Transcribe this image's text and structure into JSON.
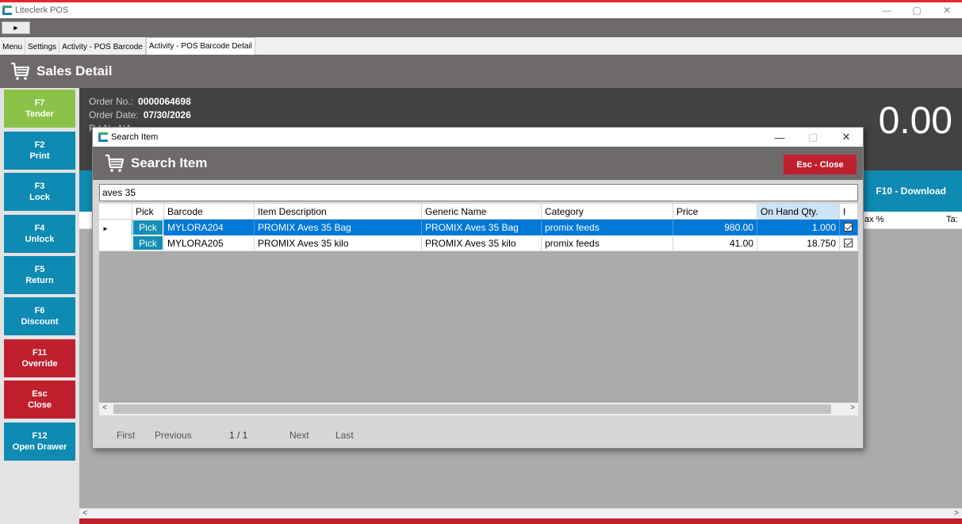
{
  "app": {
    "title": "Liteclerk POS"
  },
  "window_controls": {
    "minimize": "—",
    "maximize": "▢",
    "close": "✕"
  },
  "toolbar": {
    "play": "►"
  },
  "tabs": [
    "Menu",
    "Settings",
    "Activity - POS Barcode",
    "Activity - POS Barcode Detail"
  ],
  "header": {
    "title": "Sales Detail",
    "icon": "cart-icon"
  },
  "function_keys": [
    {
      "key": "F7",
      "label": "Tender",
      "color": "#8bc34a"
    },
    {
      "key": "F2",
      "label": "Print",
      "color": "#0e8ab3"
    },
    {
      "key": "F3",
      "label": "Lock",
      "color": "#0e8ab3"
    },
    {
      "key": "F4",
      "label": "Unlock",
      "color": "#0e8ab3"
    },
    {
      "key": "F5",
      "label": "Return",
      "color": "#0e8ab3"
    },
    {
      "key": "F6",
      "label": "Discount",
      "color": "#0e8ab3"
    },
    {
      "key": "F11",
      "label": "Override",
      "color": "#c0202e"
    },
    {
      "key": "Esc",
      "label": "Close",
      "color": "#c0202e"
    },
    {
      "key": "F12",
      "label": "Open Drawer",
      "color": "#0e8ab3"
    }
  ],
  "order": {
    "order_no_label": "Order No.:",
    "order_no": "0000064698",
    "order_date_label": "Order Date:",
    "order_date": "07/30/2026",
    "partial_label": "R    t N  : NA",
    "total": "0.00"
  },
  "background": {
    "download_button": "F10 - Download",
    "columns_visible": [
      "ax %",
      "Ta:"
    ]
  },
  "dialog": {
    "title": "Search Item",
    "heading": "Search Item",
    "close_button": "Esc - Close",
    "search_value": "aves 35",
    "columns": [
      "Pick",
      "Barcode",
      "Item Description",
      "Generic Name",
      "Category",
      "Price",
      "On Hand Qty.",
      "I"
    ],
    "rows": [
      {
        "pick": "Pick",
        "barcode": "MYLORA204",
        "description": "PROMIX Aves 35 Bag",
        "generic": "PROMIX Aves 35 Bag",
        "category": "promix feeds",
        "price": "980.00",
        "qty": "1.000",
        "checked": true,
        "selected": true
      },
      {
        "pick": "Pick",
        "barcode": "MYLORA205",
        "description": "PROMIX Aves 35 kilo",
        "generic": "PROMIX Aves 35 kilo",
        "category": "promix feeds",
        "price": "41.00",
        "qty": "18.750",
        "checked": true,
        "selected": false
      }
    ],
    "pager": {
      "first": "First",
      "previous": "Previous",
      "page": "1 / 1",
      "next": "Next",
      "last": "Last"
    }
  },
  "colors": {
    "accent_teal": "#0e8ab3",
    "accent_red": "#c0202e",
    "accent_green": "#8bc34a",
    "header_gray": "#6e6a6a",
    "selection_blue": "#0078d7"
  }
}
